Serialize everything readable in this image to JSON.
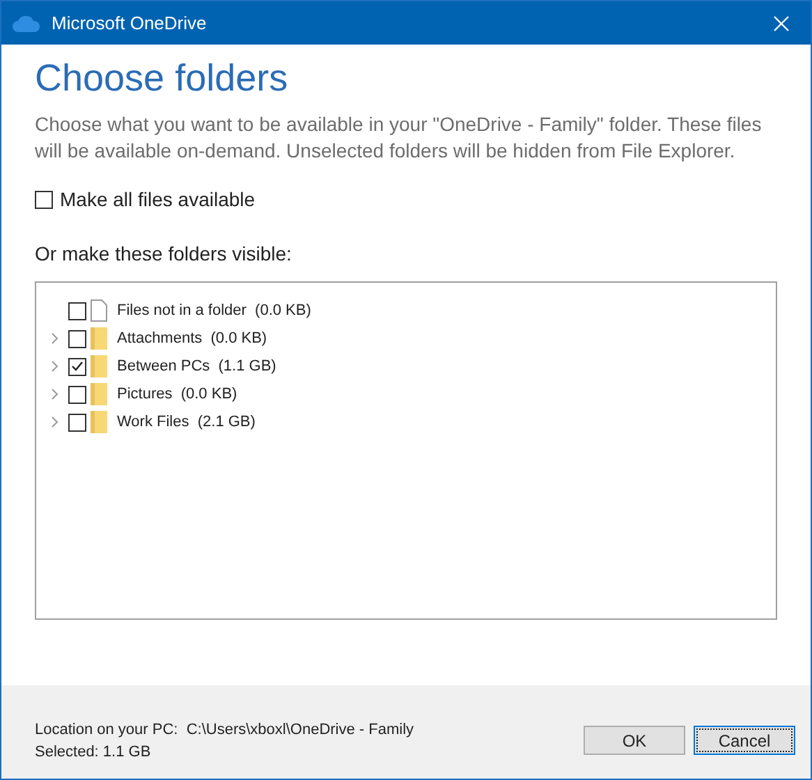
{
  "window": {
    "title": "Microsoft OneDrive"
  },
  "heading": "Choose folders",
  "description": "Choose what you want to be available in your \"OneDrive - Family\" folder. These files will be available on-demand. Unselected folders will be hidden from File Explorer.",
  "make_all": {
    "label": "Make all files available",
    "checked": false
  },
  "folders_label": "Or make these folders visible:",
  "items": [
    {
      "kind": "file",
      "name": "Files not in a folder",
      "size": "(0.0 KB)",
      "checked": false
    },
    {
      "kind": "folder",
      "name": "Attachments",
      "size": "(0.0 KB)",
      "checked": false
    },
    {
      "kind": "folder",
      "name": "Between PCs",
      "size": "(1.1 GB)",
      "checked": true
    },
    {
      "kind": "folder",
      "name": "Pictures",
      "size": "(0.0 KB)",
      "checked": false
    },
    {
      "kind": "folder",
      "name": "Work Files",
      "size": "(2.1 GB)",
      "checked": false
    }
  ],
  "location": {
    "label": "Location on your PC:",
    "path": "C:\\Users\\xboxl\\OneDrive - Family"
  },
  "selected": "Selected: 1.1 GB",
  "buttons": [
    {
      "label": "OK",
      "focused": false
    },
    {
      "label": "Cancel",
      "focused": true
    }
  ]
}
